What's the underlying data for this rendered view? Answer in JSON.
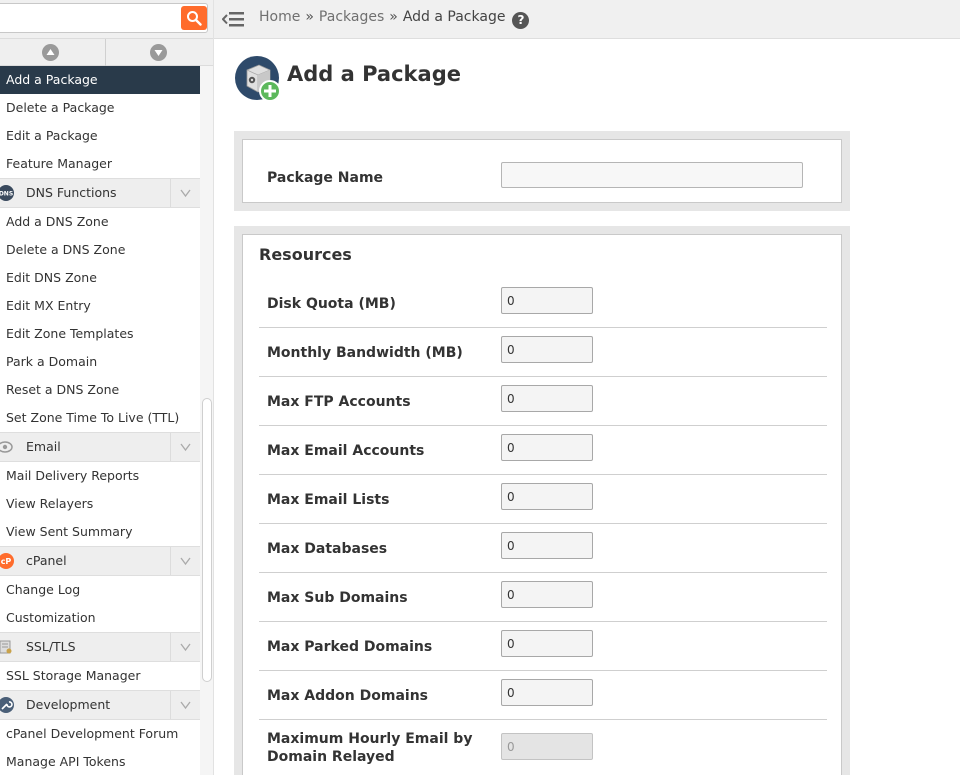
{
  "search": {
    "value": "",
    "placeholder": ""
  },
  "sidebar": {
    "items_top": [
      {
        "label": "Add a Package",
        "active": true
      },
      {
        "label": "Delete a Package"
      },
      {
        "label": "Edit a Package"
      },
      {
        "label": "Feature Manager"
      }
    ],
    "groups": [
      {
        "label": "DNS Functions",
        "icon": "dns-icon",
        "items": [
          "Add a DNS Zone",
          "Delete a DNS Zone",
          "Edit DNS Zone",
          "Edit MX Entry",
          "Edit Zone Templates",
          "Park a Domain",
          "Reset a DNS Zone",
          "Set Zone Time To Live (TTL)"
        ]
      },
      {
        "label": "Email",
        "icon": "email-icon",
        "items": [
          "Mail Delivery Reports",
          "View Relayers",
          "View Sent Summary"
        ]
      },
      {
        "label": "cPanel",
        "icon": "cpanel-logo-icon",
        "items": [
          "Change Log",
          "Customization"
        ]
      },
      {
        "label": "SSL/TLS",
        "icon": "ssl-certificate-icon",
        "items": [
          "SSL Storage Manager"
        ]
      },
      {
        "label": "Development",
        "icon": "wrench-icon",
        "items": [
          "cPanel Development Forum",
          "Manage API Tokens"
        ]
      }
    ]
  },
  "breadcrumb": {
    "home": "Home",
    "sep": "»",
    "packages": "Packages",
    "current": "Add a Package",
    "help": "?"
  },
  "page": {
    "title": "Add a Package"
  },
  "package_name": {
    "label": "Package Name",
    "value": ""
  },
  "resources": {
    "title": "Resources",
    "rows": [
      {
        "label": "Disk Quota (MB)",
        "value": "0"
      },
      {
        "label": "Monthly Bandwidth (MB)",
        "value": "0"
      },
      {
        "label": "Max FTP Accounts",
        "value": "0"
      },
      {
        "label": "Max Email Accounts",
        "value": "0"
      },
      {
        "label": "Max Email Lists",
        "value": "0"
      },
      {
        "label": "Max Databases",
        "value": "0"
      },
      {
        "label": "Max Sub Domains",
        "value": "0"
      },
      {
        "label": "Max Parked Domains",
        "value": "0"
      },
      {
        "label": "Max Addon Domains",
        "value": "0"
      },
      {
        "label": "Maximum Hourly Email by Domain Relayed",
        "value": "0",
        "disabled": true
      }
    ]
  },
  "colors": {
    "accent": "#ff6c2c",
    "active_nav": "#293a4a"
  }
}
